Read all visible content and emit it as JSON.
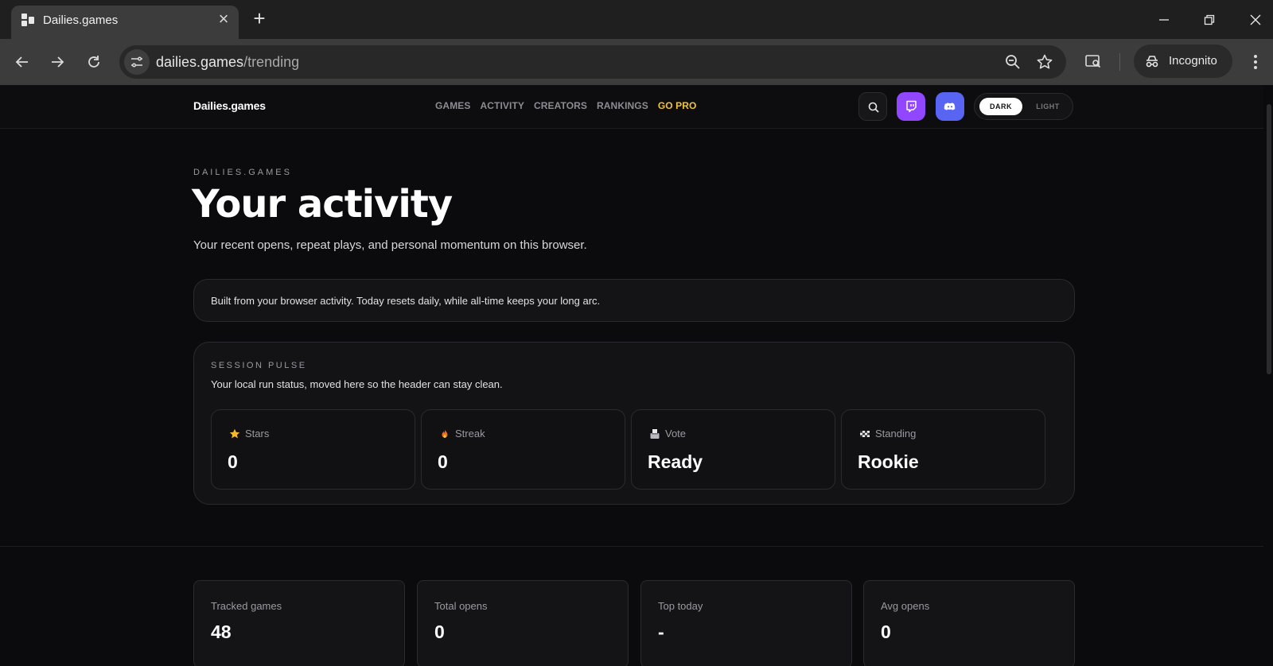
{
  "browser": {
    "tab_title": "Dailies.games",
    "url_host": "dailies.games",
    "url_path": "/trending",
    "incognito_label": "Incognito"
  },
  "site": {
    "logo": "Dailies.games",
    "nav": [
      "GAMES",
      "ACTIVITY",
      "CREATORS",
      "RANKINGS",
      "GO PRO"
    ],
    "theme_dark": "DARK",
    "theme_light": "LIGHT",
    "active_theme": "dark"
  },
  "hero": {
    "eyebrow": "DAILIES.GAMES",
    "title": "Your activity",
    "subtitle": "Your recent opens, repeat plays, and personal momentum on this browser."
  },
  "note": "Built from your browser activity. Today resets daily, while all-time keeps your long arc.",
  "session_pulse": {
    "eyebrow": "SESSION PULSE",
    "subtitle": "Your local run status, moved here so the header can stay clean.",
    "cards": [
      {
        "icon": "star-icon",
        "label": "Stars",
        "value": "0"
      },
      {
        "icon": "fire-icon",
        "label": "Streak",
        "value": "0"
      },
      {
        "icon": "ballot-box-icon",
        "label": "Vote",
        "value": "Ready"
      },
      {
        "icon": "checkered-flag-icon",
        "label": "Standing",
        "value": "Rookie"
      }
    ]
  },
  "stats": [
    {
      "label": "Tracked games",
      "value": "48"
    },
    {
      "label": "Total opens",
      "value": "0"
    },
    {
      "label": "Top today",
      "value": "-"
    },
    {
      "label": "Avg opens",
      "value": "0"
    }
  ],
  "colors": {
    "background": "#0b0b0d",
    "card": "#131316",
    "accent_pro": "#f4c430",
    "twitch": "#9146ff",
    "discord": "#5865f2"
  }
}
